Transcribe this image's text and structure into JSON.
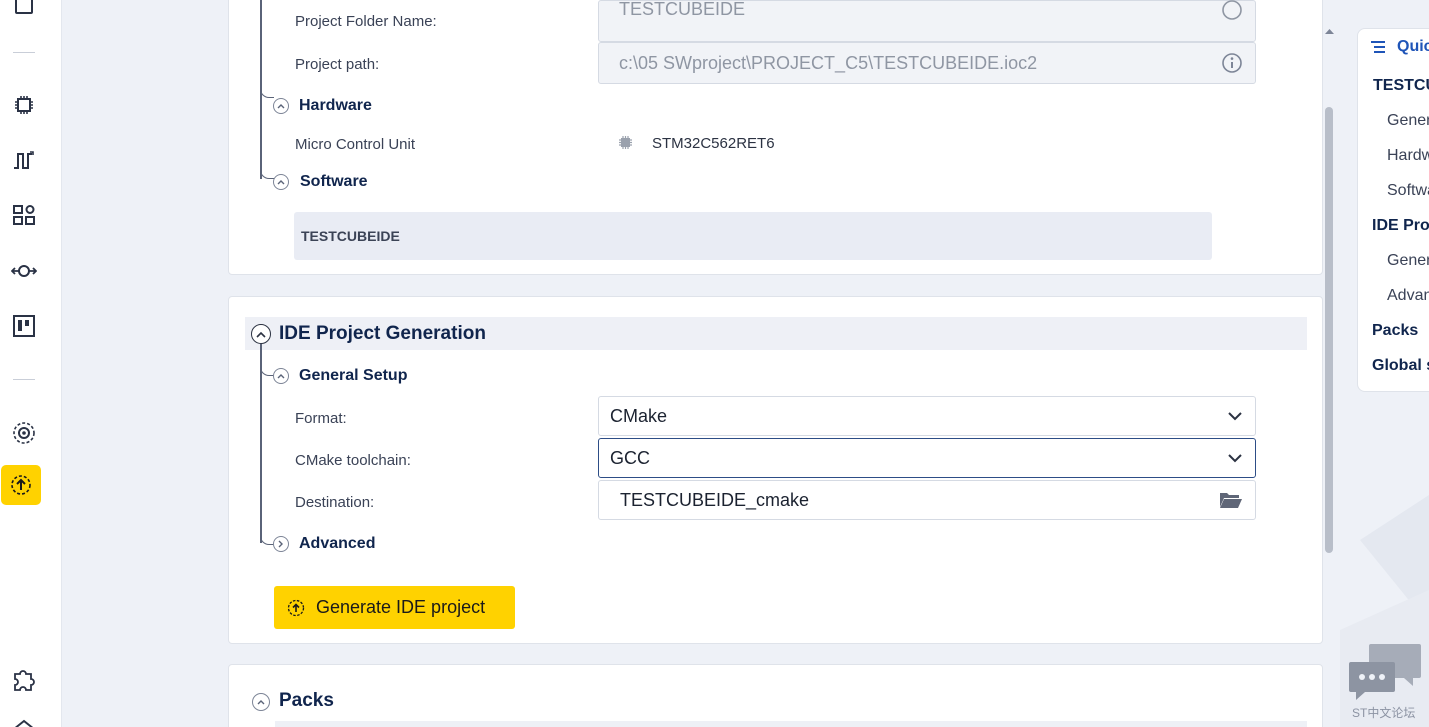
{
  "project": {
    "folder_label": "Project Folder Name:",
    "folder_value": "TESTCUBEIDE",
    "path_label": "Project path:",
    "path_value": "c:\\05 SWproject\\PROJECT_C5\\TESTCUBEIDE.ioc2",
    "hardware_heading": "Hardware",
    "mcu_label": "Micro Control Unit",
    "mcu_value": "STM32C562RET6",
    "software_heading": "Software",
    "software_item": "TESTCUBEIDE"
  },
  "ide": {
    "title": "IDE Project Generation",
    "general_heading": "General Setup",
    "format_label": "Format:",
    "format_value": "CMake",
    "toolchain_label": "CMake toolchain:",
    "toolchain_value": "GCC",
    "destination_label": "Destination:",
    "destination_value": "TESTCUBEIDE_cmake",
    "advanced_heading": "Advanced",
    "generate_button": "Generate IDE project"
  },
  "packs": {
    "title": "Packs"
  },
  "quick_nav": {
    "title": "Quic",
    "items": [
      {
        "label": "TESTCU",
        "bold": true
      },
      {
        "label": "Gener",
        "bold": false
      },
      {
        "label": "Hardw",
        "bold": false
      },
      {
        "label": "Softwa",
        "bold": false
      },
      {
        "label": "IDE Pro",
        "bold": true
      },
      {
        "label": "Gener",
        "bold": false
      },
      {
        "label": "Advan",
        "bold": false
      },
      {
        "label": "Packs",
        "bold": true
      },
      {
        "label": "Global s",
        "bold": true
      }
    ]
  },
  "chat": {
    "label": "ST中文论坛"
  },
  "colors": {
    "accent": "#ffd200",
    "heading": "#10254d",
    "focus_border": "#2d4d86"
  },
  "icons": [
    "file-icon",
    "chip-icon",
    "signal-icon",
    "blocks-icon",
    "connection-icon",
    "board-icon",
    "settings-icon",
    "generate-icon",
    "puzzle-icon",
    "home-icon"
  ]
}
